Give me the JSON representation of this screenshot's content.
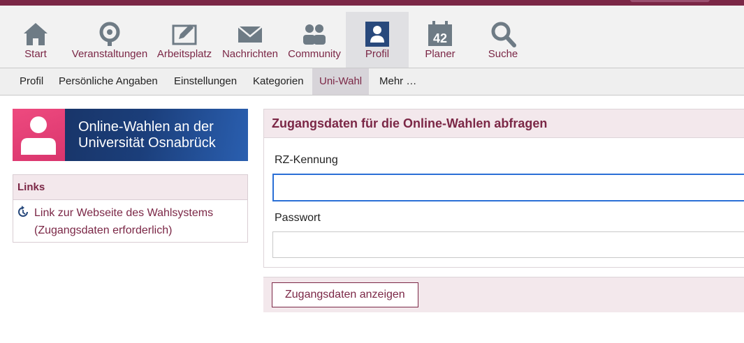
{
  "nav": {
    "items": [
      {
        "label": "Start",
        "icon": "home-icon"
      },
      {
        "label": "Veranstaltungen",
        "icon": "seminar-icon"
      },
      {
        "label": "Arbeitsplatz",
        "icon": "workplace-icon"
      },
      {
        "label": "Nachrichten",
        "icon": "mail-icon"
      },
      {
        "label": "Community",
        "icon": "community-icon"
      },
      {
        "label": "Profil",
        "icon": "person-icon",
        "active": true
      },
      {
        "label": "Planer",
        "icon": "calendar-icon",
        "badge": "42"
      },
      {
        "label": "Suche",
        "icon": "search-icon"
      }
    ]
  },
  "subnav": {
    "items": [
      {
        "label": "Profil"
      },
      {
        "label": "Persönliche Angaben"
      },
      {
        "label": "Einstellungen"
      },
      {
        "label": "Kategorien"
      },
      {
        "label": "Uni-Wahl",
        "active": true
      },
      {
        "label": "Mehr …"
      }
    ]
  },
  "banner": {
    "line1": "Online-Wahlen an der",
    "line2": "Universität Osnabrück"
  },
  "links": {
    "title": "Links",
    "link_line1": "Link zur Webseite des Wahlsystems",
    "link_line2": "(Zugangsdaten erforderlich)"
  },
  "form": {
    "title": "Zugangsdaten für die Online-Wahlen abfragen",
    "rz_label": "RZ-Kennung",
    "rz_value": "",
    "password_label": "Passwort",
    "password_value": "",
    "submit_label": "Zugangsdaten anzeigen"
  },
  "colors": {
    "brand": "#7b2746",
    "focus": "#2a6fd6",
    "icon_gray": "#6e7b85",
    "icon_active": "#28497c"
  }
}
